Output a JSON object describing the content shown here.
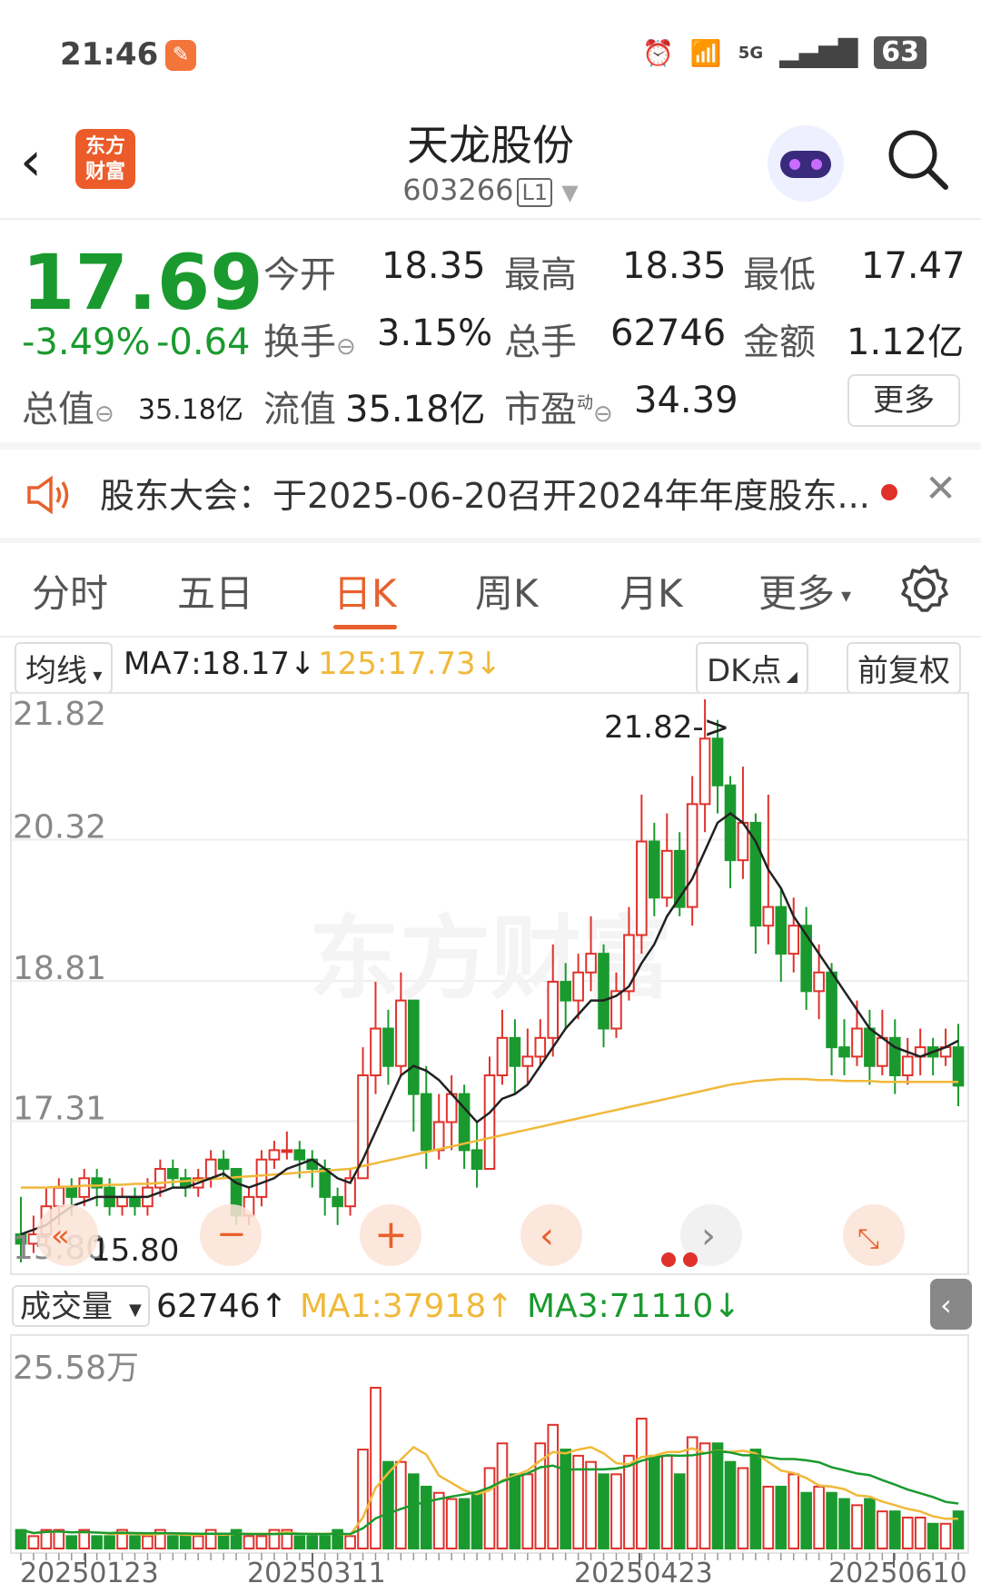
{
  "status": {
    "time": "21:46",
    "network": "5G",
    "battery": "63"
  },
  "header": {
    "title": "天龙股份",
    "code": "603266",
    "level": "L1",
    "logo_line1": "东方",
    "logo_line2": "财富"
  },
  "quote": {
    "price": "17.69",
    "pct": "-3.49%",
    "change": "-0.64",
    "open_label": "今开",
    "open": "18.35",
    "high_label": "最高",
    "high": "18.35",
    "low_label": "最低",
    "low": "17.47",
    "turnover_label": "换手",
    "turnover": "3.15%",
    "volume_label": "总手",
    "volume": "62746",
    "amount_label": "金额",
    "amount": "1.12亿",
    "mktcap_label": "总值",
    "mktcap": "35.18亿",
    "float_label": "流值",
    "float": "35.18亿",
    "pe_label": "市盈",
    "pe_sup": "动",
    "pe": "34.39",
    "more": "更多"
  },
  "notice": {
    "text": "股东大会：于2025-06-20召开2024年年度股东..."
  },
  "tabs": [
    "分时",
    "五日",
    "日K",
    "周K",
    "月K",
    "更多"
  ],
  "active_tab": "日K",
  "chart_header": {
    "ma_select": "均线",
    "ma7": "MA7:18.17↓",
    "ma125": "125:17.73↓",
    "dk": "DK点",
    "adjust": "前复权"
  },
  "price_axis": [
    "21.82",
    "20.32",
    "18.81",
    "17.31",
    "15.80"
  ],
  "high_marker": "21.82->",
  "low_marker": "15.80",
  "volume_header": {
    "select": "成交量",
    "vol": "62746↑",
    "ma1": "MA1:37918↑",
    "ma3": "MA3:71110↓"
  },
  "volume_axis_max": "25.58万",
  "date_axis": [
    "20250123",
    "20250311",
    "20250423",
    "20250610"
  ],
  "colors": {
    "up": "#e0312b",
    "down": "#1a9a2e",
    "ma7": "#222222",
    "ma125": "#f0b93a",
    "accent": "#e8602d"
  },
  "chart_data": {
    "type": "candlestick",
    "ylim": [
      15.8,
      21.82
    ],
    "candles": [
      [
        16.1,
        16.0,
        16.5,
        15.8
      ],
      [
        16.0,
        16.1,
        16.3,
        15.9
      ],
      [
        16.1,
        16.4,
        16.6,
        16.0
      ],
      [
        16.4,
        16.6,
        16.7,
        16.2
      ],
      [
        16.6,
        16.5,
        16.7,
        16.3
      ],
      [
        16.5,
        16.7,
        16.8,
        16.4
      ],
      [
        16.7,
        16.6,
        16.8,
        16.4
      ],
      [
        16.6,
        16.4,
        16.7,
        16.3
      ],
      [
        16.4,
        16.5,
        16.6,
        16.3
      ],
      [
        16.5,
        16.4,
        16.6,
        16.3
      ],
      [
        16.4,
        16.6,
        16.7,
        16.3
      ],
      [
        16.6,
        16.8,
        16.9,
        16.5
      ],
      [
        16.8,
        16.7,
        16.9,
        16.6
      ],
      [
        16.7,
        16.6,
        16.8,
        16.5
      ],
      [
        16.6,
        16.7,
        16.8,
        16.5
      ],
      [
        16.7,
        16.9,
        17.0,
        16.6
      ],
      [
        16.9,
        16.8,
        17.0,
        16.7
      ],
      [
        16.8,
        16.3,
        16.8,
        16.2
      ],
      [
        16.3,
        16.5,
        16.6,
        16.2
      ],
      [
        16.5,
        16.9,
        17.0,
        16.4
      ],
      [
        16.9,
        17.0,
        17.1,
        16.8
      ],
      [
        17.0,
        17.0,
        17.2,
        16.9
      ],
      [
        17.0,
        16.9,
        17.1,
        16.7
      ],
      [
        16.9,
        16.8,
        17.0,
        16.6
      ],
      [
        16.8,
        16.5,
        16.9,
        16.3
      ],
      [
        16.5,
        16.4,
        16.6,
        16.2
      ],
      [
        16.4,
        16.7,
        16.8,
        16.3
      ],
      [
        16.7,
        17.8,
        18.1,
        16.7
      ],
      [
        17.8,
        18.3,
        18.8,
        17.6
      ],
      [
        18.3,
        17.9,
        18.5,
        17.7
      ],
      [
        17.9,
        18.6,
        18.9,
        17.8
      ],
      [
        18.6,
        17.6,
        18.6,
        17.2
      ],
      [
        17.6,
        17.0,
        17.9,
        16.8
      ],
      [
        17.0,
        17.3,
        17.6,
        16.9
      ],
      [
        17.3,
        17.6,
        17.8,
        17.0
      ],
      [
        17.6,
        17.0,
        17.7,
        16.8
      ],
      [
        17.0,
        16.8,
        17.3,
        16.6
      ],
      [
        16.8,
        17.8,
        18.0,
        16.8
      ],
      [
        17.8,
        18.2,
        18.5,
        17.7
      ],
      [
        18.2,
        17.9,
        18.4,
        17.6
      ],
      [
        17.9,
        18.0,
        18.3,
        17.7
      ],
      [
        18.0,
        18.2,
        18.4,
        17.9
      ],
      [
        18.2,
        18.8,
        19.2,
        18.0
      ],
      [
        18.8,
        18.6,
        19.0,
        18.3
      ],
      [
        18.6,
        18.9,
        19.1,
        18.4
      ],
      [
        18.9,
        19.1,
        19.5,
        18.7
      ],
      [
        19.1,
        18.3,
        19.2,
        18.1
      ],
      [
        18.3,
        18.7,
        18.9,
        18.2
      ],
      [
        18.7,
        19.3,
        19.6,
        18.6
      ],
      [
        19.3,
        20.3,
        20.8,
        19.1
      ],
      [
        20.3,
        19.7,
        20.5,
        19.5
      ],
      [
        19.7,
        20.2,
        20.6,
        19.6
      ],
      [
        20.2,
        19.6,
        20.4,
        19.5
      ],
      [
        19.6,
        20.7,
        21.0,
        19.4
      ],
      [
        20.7,
        21.4,
        21.82,
        20.4
      ],
      [
        21.4,
        20.9,
        21.6,
        20.6
      ],
      [
        20.9,
        20.1,
        21.0,
        19.8
      ],
      [
        20.1,
        20.5,
        21.1,
        19.9
      ],
      [
        20.5,
        19.4,
        20.6,
        19.1
      ],
      [
        19.4,
        19.6,
        20.8,
        19.2
      ],
      [
        19.6,
        19.1,
        19.8,
        18.8
      ],
      [
        19.1,
        19.4,
        19.7,
        18.9
      ],
      [
        19.4,
        18.7,
        19.6,
        18.5
      ],
      [
        18.7,
        18.9,
        19.2,
        18.4
      ],
      [
        18.9,
        18.1,
        19.0,
        17.8
      ],
      [
        18.1,
        18.0,
        18.4,
        17.8
      ],
      [
        18.0,
        18.3,
        18.6,
        17.9
      ],
      [
        18.3,
        17.9,
        18.5,
        17.7
      ],
      [
        17.9,
        18.2,
        18.5,
        17.8
      ],
      [
        18.2,
        17.8,
        18.4,
        17.6
      ],
      [
        17.8,
        18.0,
        18.2,
        17.7
      ],
      [
        18.0,
        18.1,
        18.3,
        17.8
      ],
      [
        18.1,
        18.0,
        18.2,
        17.8
      ],
      [
        18.0,
        18.1,
        18.3,
        17.9
      ],
      [
        18.1,
        17.69,
        18.35,
        17.47
      ]
    ],
    "ma7": [
      16.1,
      16.15,
      16.2,
      16.3,
      16.4,
      16.45,
      16.5,
      16.5,
      16.5,
      16.5,
      16.5,
      16.55,
      16.6,
      16.6,
      16.65,
      16.7,
      16.75,
      16.65,
      16.6,
      16.65,
      16.7,
      16.8,
      16.85,
      16.9,
      16.8,
      16.7,
      16.65,
      16.9,
      17.2,
      17.5,
      17.8,
      17.9,
      17.85,
      17.75,
      17.6,
      17.45,
      17.3,
      17.4,
      17.55,
      17.6,
      17.7,
      17.9,
      18.1,
      18.3,
      18.45,
      18.6,
      18.6,
      18.65,
      18.75,
      19.0,
      19.2,
      19.5,
      19.7,
      19.9,
      20.2,
      20.5,
      20.6,
      20.5,
      20.3,
      20.0,
      19.8,
      19.5,
      19.3,
      19.1,
      18.9,
      18.7,
      18.5,
      18.3,
      18.2,
      18.1,
      18.05,
      18.0,
      18.05,
      18.1,
      18.17
    ],
    "ma125": [
      16.6,
      16.6,
      16.6,
      16.61,
      16.61,
      16.62,
      16.62,
      16.63,
      16.63,
      16.64,
      16.64,
      16.65,
      16.66,
      16.67,
      16.68,
      16.69,
      16.7,
      16.71,
      16.72,
      16.73,
      16.74,
      16.75,
      16.76,
      16.77,
      16.78,
      16.79,
      16.8,
      16.83,
      16.86,
      16.89,
      16.92,
      16.95,
      16.98,
      17.01,
      17.04,
      17.07,
      17.1,
      17.13,
      17.16,
      17.19,
      17.22,
      17.25,
      17.28,
      17.31,
      17.34,
      17.37,
      17.4,
      17.43,
      17.46,
      17.49,
      17.52,
      17.55,
      17.58,
      17.61,
      17.64,
      17.67,
      17.7,
      17.72,
      17.74,
      17.75,
      17.76,
      17.76,
      17.76,
      17.75,
      17.75,
      17.74,
      17.74,
      17.74,
      17.73,
      17.73,
      17.73,
      17.73,
      17.73,
      17.73,
      17.73
    ],
    "volume": [
      3,
      2,
      3,
      3,
      2,
      3,
      2,
      2,
      3,
      2,
      2,
      3,
      2,
      2,
      2,
      3,
      2,
      3,
      2,
      2,
      3,
      3,
      2,
      2,
      2,
      3,
      2,
      16,
      26,
      14,
      14,
      12,
      10,
      9,
      8,
      8,
      9,
      13,
      17,
      12,
      12,
      17,
      20,
      16,
      15,
      14,
      12,
      12,
      15,
      21,
      15,
      15,
      12,
      18,
      17,
      17,
      14,
      13,
      16,
      10,
      10,
      12,
      9,
      10,
      9,
      8,
      7,
      8,
      6,
      6,
      5,
      5,
      4,
      4,
      6
    ]
  }
}
